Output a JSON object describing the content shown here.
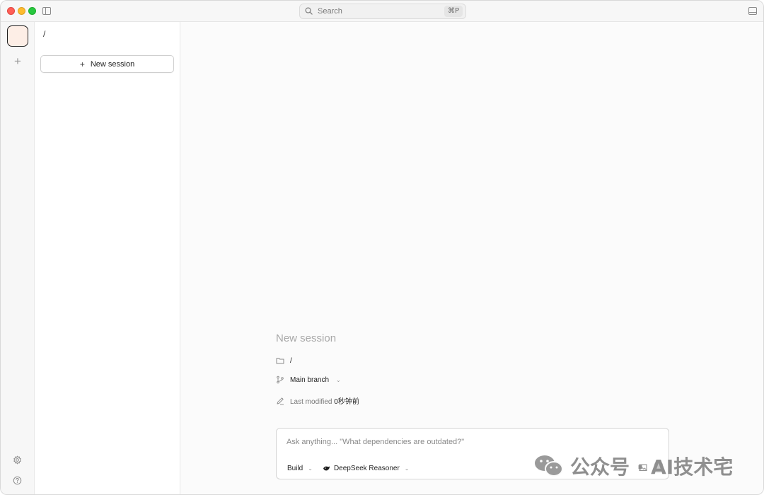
{
  "titlebar": {
    "search_label": "Search",
    "search_shortcut": "⌘P"
  },
  "rail": {
    "add_label": "+"
  },
  "sidebar": {
    "project_path": "/",
    "new_session_label": "New session"
  },
  "main": {
    "session_title": "New session",
    "folder_path": "/",
    "branch_label": "Main branch",
    "modified_label": "Last modified",
    "modified_value": "0秒钟前"
  },
  "composer": {
    "placeholder": "Ask anything... \"What dependencies are outdated?\"",
    "mode_label": "Build",
    "model_label": "DeepSeek Reasoner"
  },
  "watermark": {
    "text": "公众号 · AI技术宅"
  },
  "colors": {
    "accent_tile": "#fdeee6",
    "close": "#ff5f57",
    "minimize": "#febc2e",
    "zoom": "#28c840"
  }
}
